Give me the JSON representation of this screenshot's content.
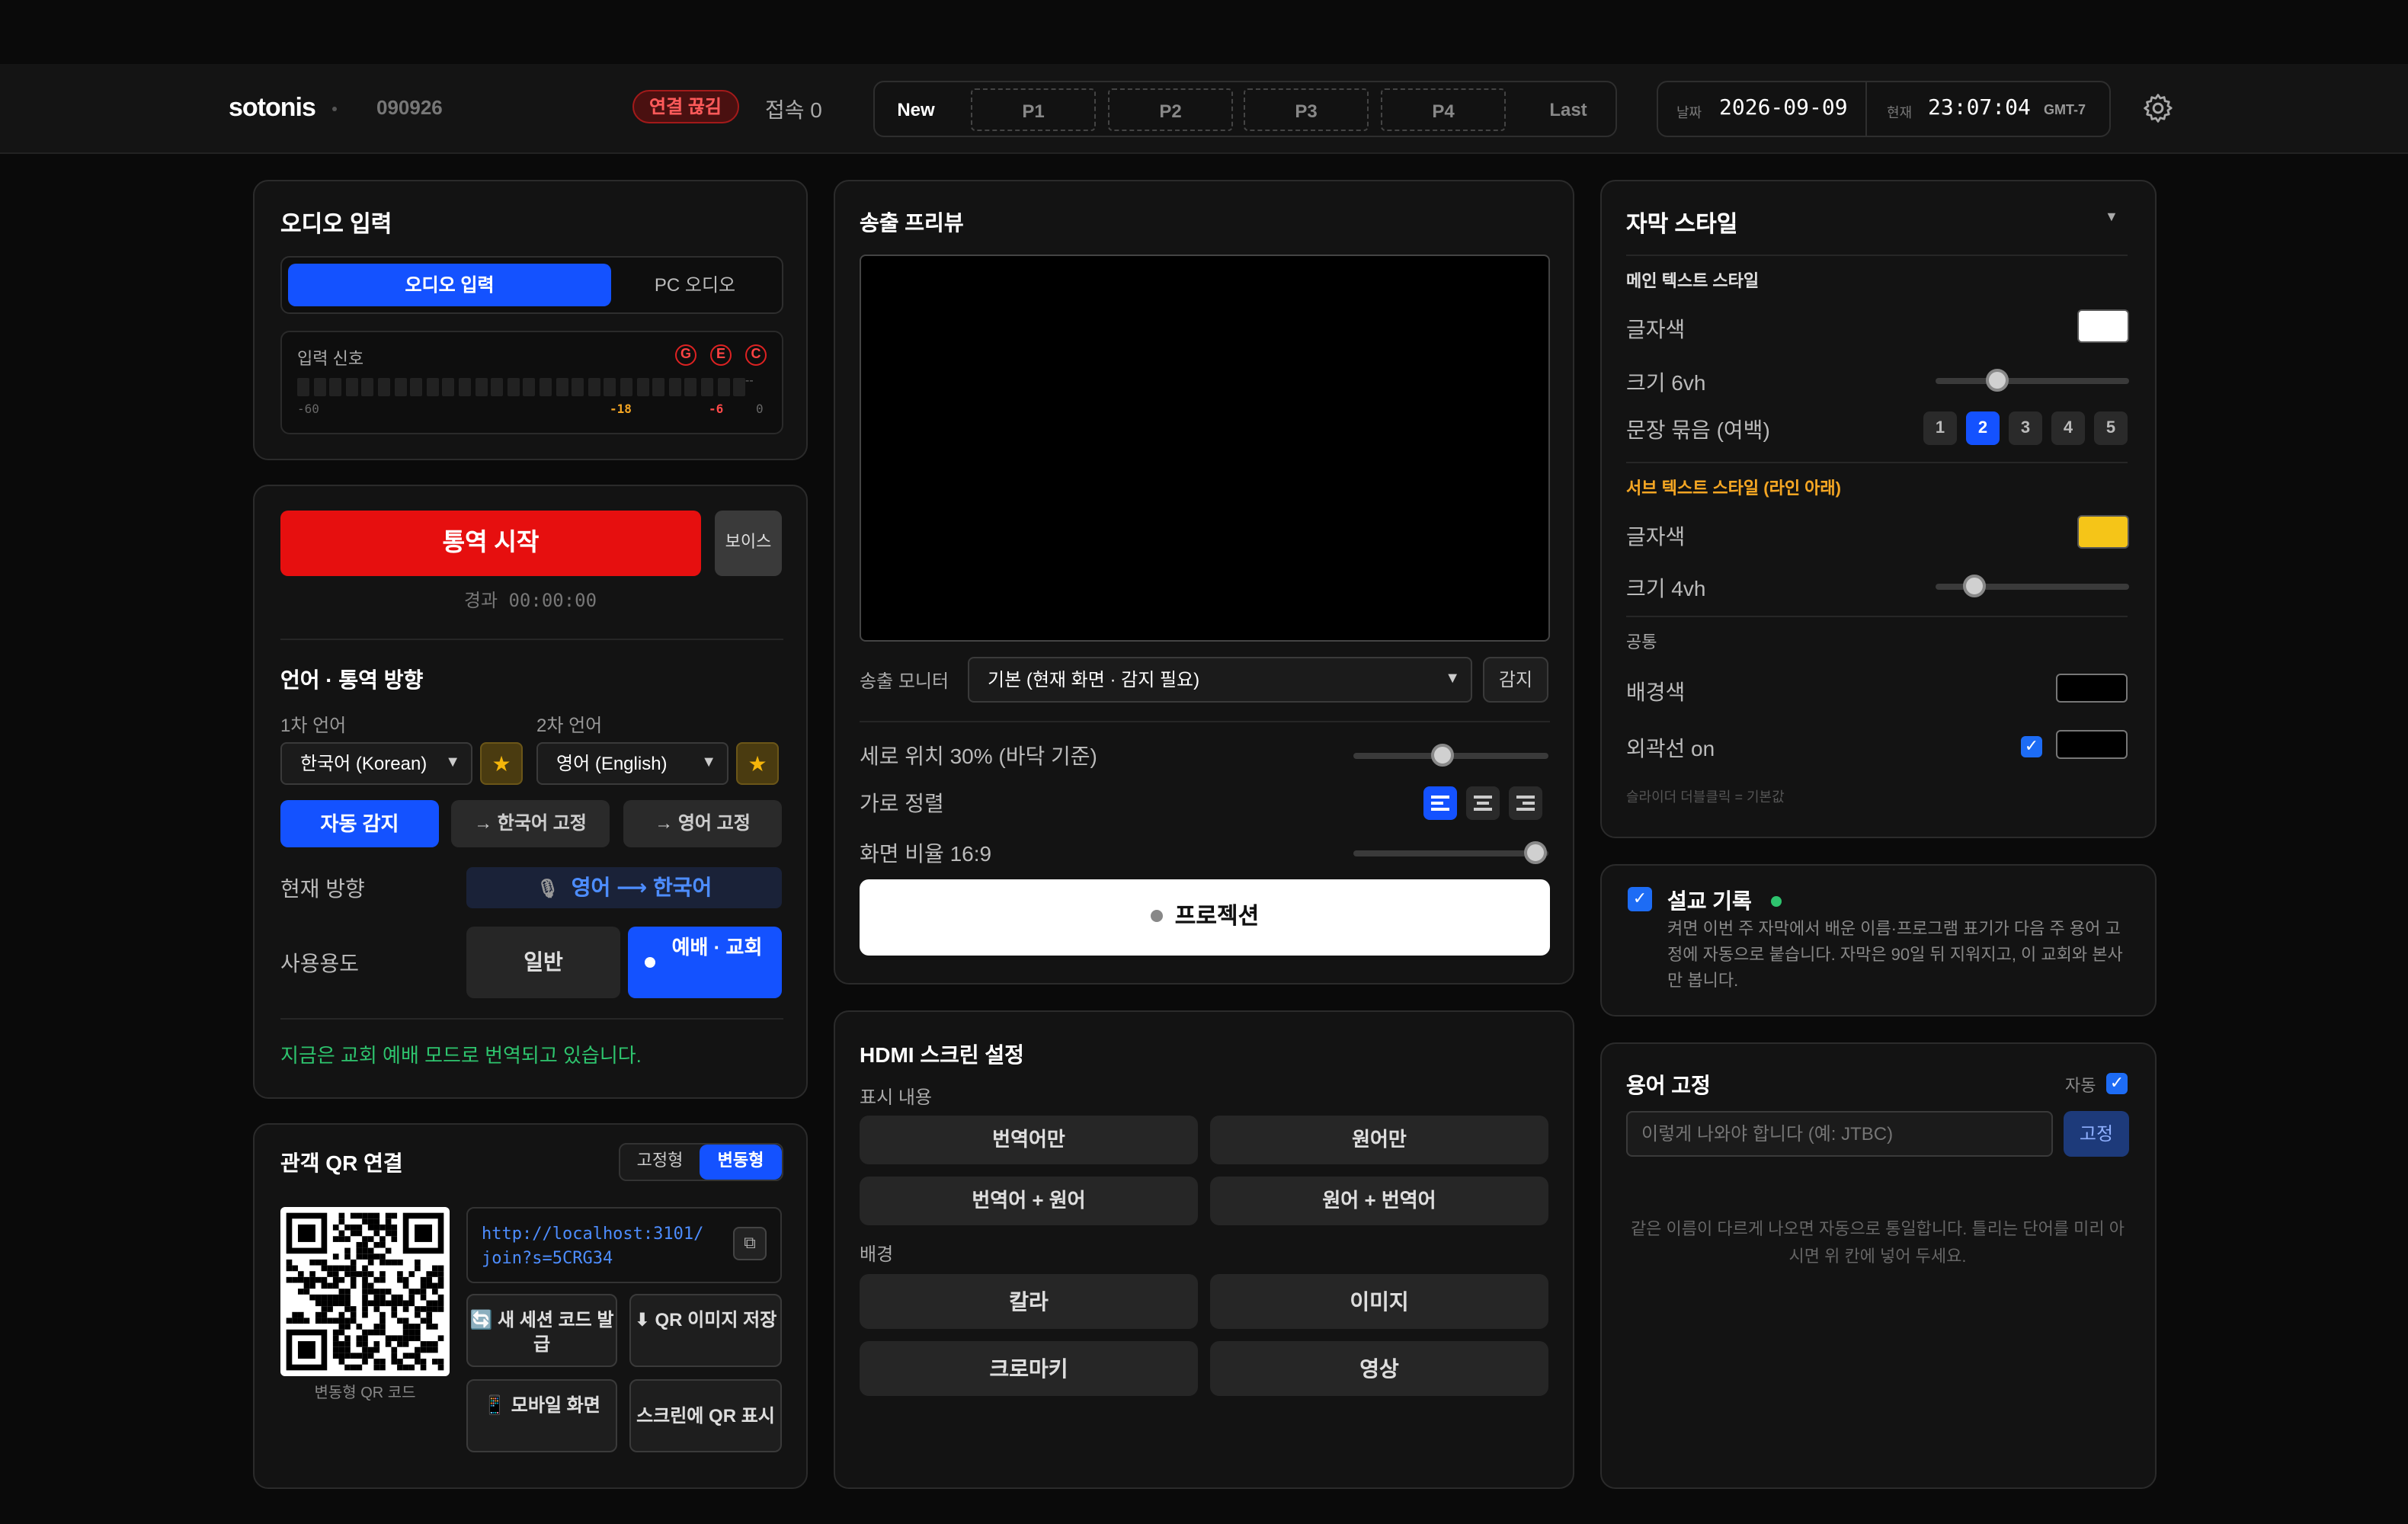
{
  "header": {
    "logo": "sotonis",
    "session_code": "090926",
    "status_badge": "연결 끊김",
    "connections": "접속 0",
    "pages": [
      "New",
      "P1",
      "P2",
      "P3",
      "P4",
      "Last"
    ],
    "date_label": "날짜",
    "date": "2026-09-09",
    "time_label": "현재",
    "time": "23:07:04",
    "tz": "GMT-7"
  },
  "audio": {
    "title": "오디오 입력",
    "tab_input": "오디오 입력",
    "tab_pc": "PC 오디오",
    "signal_label": "입력 신호",
    "flags": [
      "G",
      "E",
      "C"
    ],
    "scale": [
      "-60",
      "-18",
      "-6",
      "0"
    ],
    "peak": "--"
  },
  "control": {
    "start": "통역 시작",
    "voice": "보이스",
    "elapsed": "경과 00:00:00",
    "lang_title": "언어 · 통역 방향",
    "lang1_label": "1차 언어",
    "lang1": "한국어 (Korean)",
    "lang2_label": "2차 언어",
    "lang2": "영어 (English)",
    "auto": "자동 감지",
    "fix_ko": "→ 한국어 고정",
    "fix_en": "→ 영어 고정",
    "dir_label": "현재 방향",
    "dir_from": "영어",
    "dir_to": "한국어",
    "usage_label": "사용용도",
    "usage_general": "일반",
    "usage_worship": "예배 · 교회",
    "note": "지금은 교회 예배 모드로 번역되고 있습니다."
  },
  "qr": {
    "title": "관객 QR 연결",
    "fixed": "고정형",
    "dynamic": "변동형",
    "url": "http://localhost:3101/join?s=5CRG34",
    "caption": "변동형 QR 코드",
    "new_code": "🔄 새 세션 코드 발급",
    "save": "⬇ QR 이미지 저장",
    "mobile": "📱 모바일 화면",
    "screen": "스크린에 QR 표시"
  },
  "preview": {
    "title": "송출 프리뷰",
    "monitor_label": "송출 모니터",
    "monitor_value": "기본 (현재 화면 · 감지 필요)",
    "detect": "감지",
    "vpos": "세로 위치 30% (바닥 기준)",
    "vpos_value": 30,
    "halign": "가로 정렬",
    "ratio": "화면 비율 16:9",
    "projection": "프로젝션"
  },
  "hdmi": {
    "title": "HDMI 스크린 설정",
    "content_label": "표시 내용",
    "opt1": "번역어만",
    "opt2": "원어만",
    "opt3": "번역어 + 원어",
    "opt4": "원어 + 번역어",
    "bg_label": "배경",
    "bg1": "칼라",
    "bg2": "이미지",
    "bg3": "크로마키",
    "bg4": "영상"
  },
  "style": {
    "title": "자막 스타일",
    "main_title": "메인 텍스트 스타일",
    "color_label": "글자색",
    "main_size": "크기 6vh",
    "grouping": "문장 묶음 (여백)",
    "groups": [
      "1",
      "2",
      "3",
      "4",
      "5"
    ],
    "sub_title": "서브 텍스트 스타일 (라인 아래)",
    "sub_color_label": "글자색",
    "sub_size": "크기 4vh",
    "common": "공통",
    "bg_color": "배경색",
    "outline": "외곽선 on",
    "hint": "슬라이더 더블클릭 = 기본값",
    "colors": {
      "main": "#ffffff",
      "sub": "#f5c518",
      "bg": "#000000",
      "outline": "#000000"
    }
  },
  "sermon": {
    "title": "설교 기록",
    "desc": "켜면 이번 주 자막에서 배운 이름·프로그램 표기가 다음 주 용어 고정에 자동으로 붙습니다. 자막은 90일 뒤 지워지고, 이 교회와 본사만 봅니다."
  },
  "terms": {
    "title": "용어 고정",
    "auto": "자동",
    "placeholder": "이렇게 나와야 합니다 (예: JTBC)",
    "fix": "고정",
    "hint": "같은 이름이 다르게 나오면 자동으로 통일합니다. 틀리는 단어를 미리 아시면 위 칸에 넣어 두세요."
  }
}
